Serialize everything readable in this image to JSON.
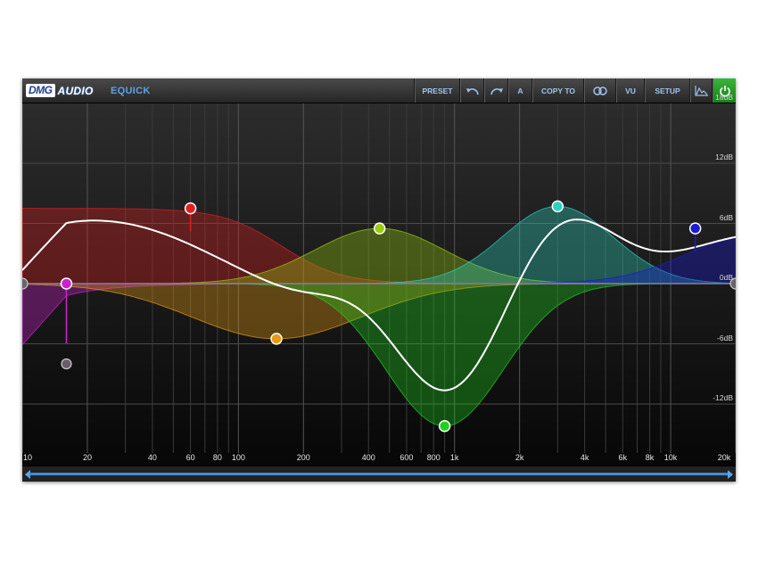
{
  "plugin": {
    "brand_left": "DMG",
    "brand_right": "AUDIO",
    "product": "EQUICK"
  },
  "toolbar": {
    "preset": "PRESET",
    "ab": "A",
    "copy_to": "COPY TO",
    "vu": "VU",
    "setup": "SETUP",
    "undo_icon": "undo-icon",
    "redo_icon": "redo-icon",
    "link_icon": "link-icon",
    "spectrum_icon": "spectrum-icon",
    "power_icon": "power-icon",
    "power_color": "#2ca52c"
  },
  "db_labels": [
    "18dB",
    "12dB",
    "6dB",
    "0dB",
    "-6dB",
    "-12dB"
  ],
  "freq_labels": [
    "10",
    "20",
    "40",
    "60",
    "80",
    "100",
    "200",
    "400",
    "600",
    "800",
    "1k",
    "2k",
    "4k",
    "6k",
    "8k",
    "10k",
    "20k"
  ],
  "bands": [
    {
      "name": "low-cut",
      "color": "#cc22cc",
      "freq_hz": 16,
      "gain_db": 0,
      "type": "highpass"
    },
    {
      "name": "low-shelf",
      "color": "#e02020",
      "freq_hz": 60,
      "gain_db": 7.5,
      "type": "lowshelf"
    },
    {
      "name": "low-mid",
      "color": "#e89a10",
      "freq_hz": 150,
      "gain_db": -5.5,
      "type": "peak"
    },
    {
      "name": "mid",
      "color": "#9acd10",
      "freq_hz": 450,
      "gain_db": 5.5,
      "type": "peak"
    },
    {
      "name": "high-mid",
      "color": "#20d020",
      "freq_hz": 900,
      "gain_db": -14.2,
      "type": "peak"
    },
    {
      "name": "presence",
      "color": "#30d0c0",
      "freq_hz": 3000,
      "gain_db": 7.7,
      "type": "peak"
    },
    {
      "name": "high-shelf",
      "color": "#1a1ad8",
      "freq_hz": 13000,
      "gain_db": 5.5,
      "type": "highshelf"
    }
  ],
  "colors": {
    "curve": "#ffffff",
    "accent": "#5aa3e6"
  }
}
